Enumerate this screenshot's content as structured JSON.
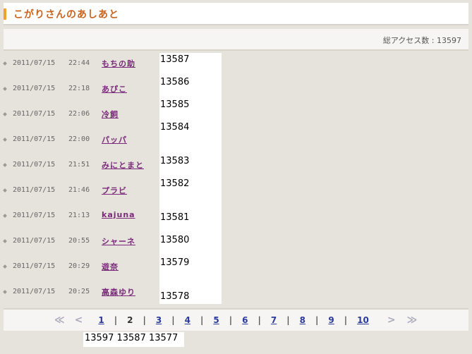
{
  "title": "こがりさんのあしあと",
  "access_count": "総アクセス数 : 13597",
  "visits": [
    {
      "date": "2011/07/15",
      "time": "22:44",
      "name": "もちの助"
    },
    {
      "date": "2011/07/15",
      "time": "22:18",
      "name": "あぴこ"
    },
    {
      "date": "2011/07/15",
      "time": "22:06",
      "name": "冷飼"
    },
    {
      "date": "2011/07/15",
      "time": "22:00",
      "name": "パッパ"
    },
    {
      "date": "2011/07/15",
      "time": "21:51",
      "name": "みにとまと"
    },
    {
      "date": "2011/07/15",
      "time": "21:46",
      "name": "プラビ"
    },
    {
      "date": "2011/07/15",
      "time": "21:13",
      "name": "kajuna"
    },
    {
      "date": "2011/07/15",
      "time": "20:55",
      "name": "シャーネ"
    },
    {
      "date": "2011/07/15",
      "time": "20:29",
      "name": "遊奈"
    },
    {
      "date": "2011/07/15",
      "time": "20:25",
      "name": "高森ゆり"
    }
  ],
  "numbers": [
    "13587",
    "13586",
    "13585",
    "13584",
    "13583",
    "13582",
    "13581",
    "13580",
    "13579",
    "13578"
  ],
  "pager": {
    "first": "≪",
    "prev": "<",
    "pages": [
      "1",
      "2",
      "3",
      "4",
      "5",
      "6",
      "7",
      "8",
      "9",
      "10"
    ],
    "current": "2",
    "separator": "|",
    "next": ">",
    "last": "≫"
  },
  "bottom_numbers": "13597 13587 13577",
  "colors": {
    "accent": "#f0a030",
    "title": "#c8641e",
    "user_link": "#7a2a7a",
    "page_link": "#2a3a9a"
  }
}
